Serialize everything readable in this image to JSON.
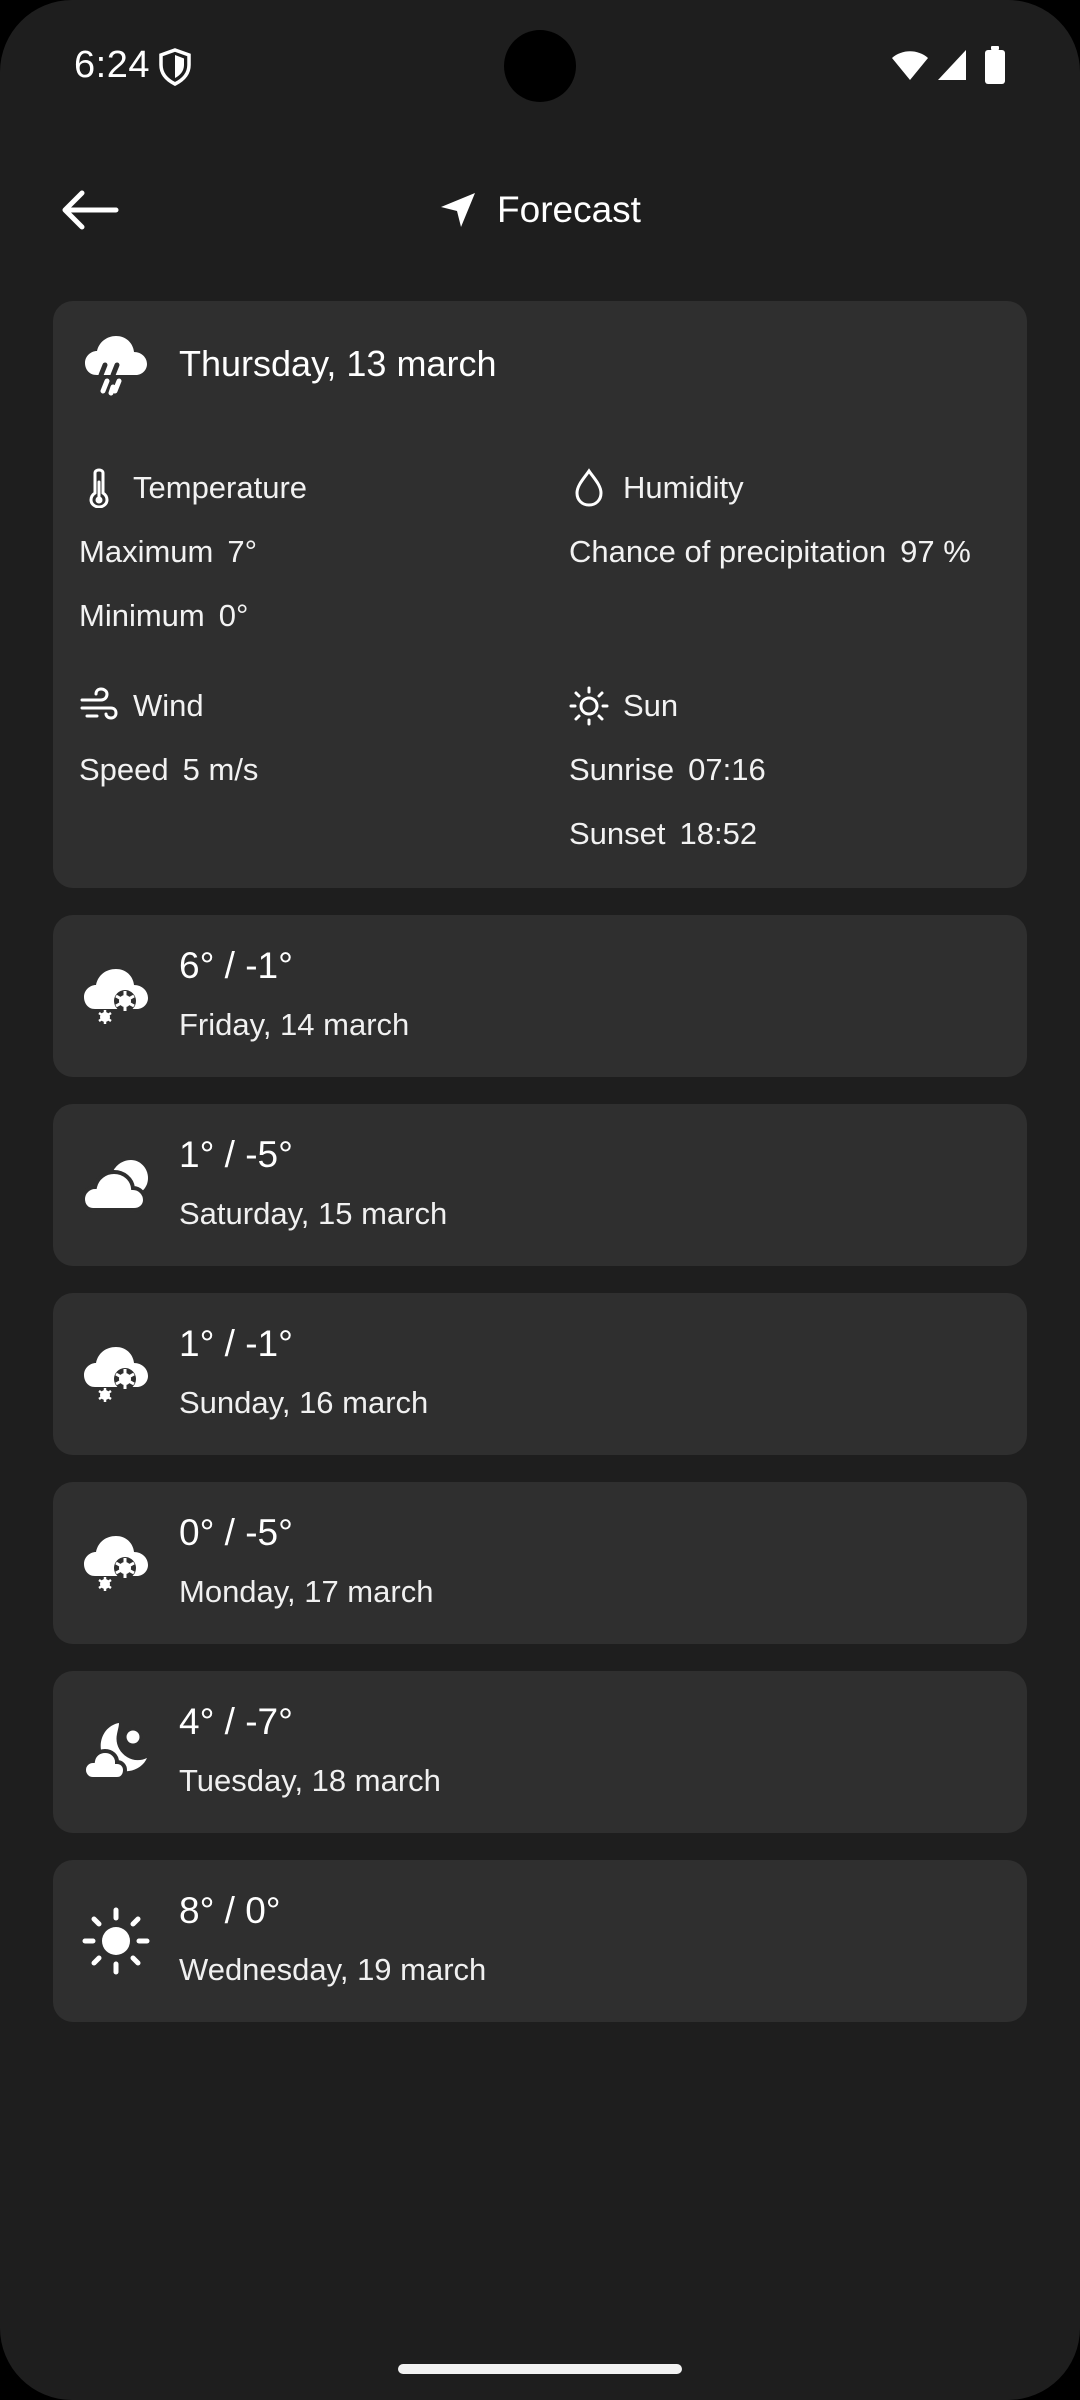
{
  "status_bar": {
    "time": "6:24",
    "icons": [
      "shield-icon",
      "wifi-icon",
      "signal-icon",
      "battery-icon"
    ]
  },
  "app_bar": {
    "back_icon": "arrow-left-icon",
    "nav_icon": "navigation-arrow-icon",
    "title": "Forecast"
  },
  "today": {
    "icon": "rain-cloud-icon",
    "date": "Thursday, 13 march",
    "temperature": {
      "icon": "thermometer-icon",
      "label": "Temperature",
      "max_label": "Maximum",
      "max_value": "7°",
      "min_label": "Minimum",
      "min_value": "0°"
    },
    "humidity": {
      "icon": "water-drop-icon",
      "label": "Humidity",
      "precip_label": "Chance of precipitation",
      "precip_value": "97 %"
    },
    "wind": {
      "icon": "wind-icon",
      "label": "Wind",
      "speed_label": "Speed",
      "speed_value": "5 m/s"
    },
    "sun": {
      "icon": "sun-icon",
      "label": "Sun",
      "sunrise_label": "Sunrise",
      "sunrise_value": "07:16",
      "sunset_label": "Sunset",
      "sunset_value": "18:52"
    }
  },
  "days": [
    {
      "icon": "snow-cloud-icon",
      "temps": "6° / -1°",
      "date": "Friday, 14 march"
    },
    {
      "icon": "cloudy-icon",
      "temps": "1° / -5°",
      "date": "Saturday, 15 march"
    },
    {
      "icon": "snow-cloud-icon",
      "temps": "1° / -1°",
      "date": "Sunday, 16 march"
    },
    {
      "icon": "snow-cloud-icon",
      "temps": "0° / -5°",
      "date": "Monday, 17 march"
    },
    {
      "icon": "night-partly-cloudy-icon",
      "temps": "4° / -7°",
      "date": "Tuesday, 18 march"
    },
    {
      "icon": "sun-icon",
      "temps": "8° / 0°",
      "date": "Wednesday, 19 march"
    }
  ],
  "colors": {
    "background": "#1e1e1e",
    "card": "#2f2f2f",
    "text": "#ffffff"
  }
}
